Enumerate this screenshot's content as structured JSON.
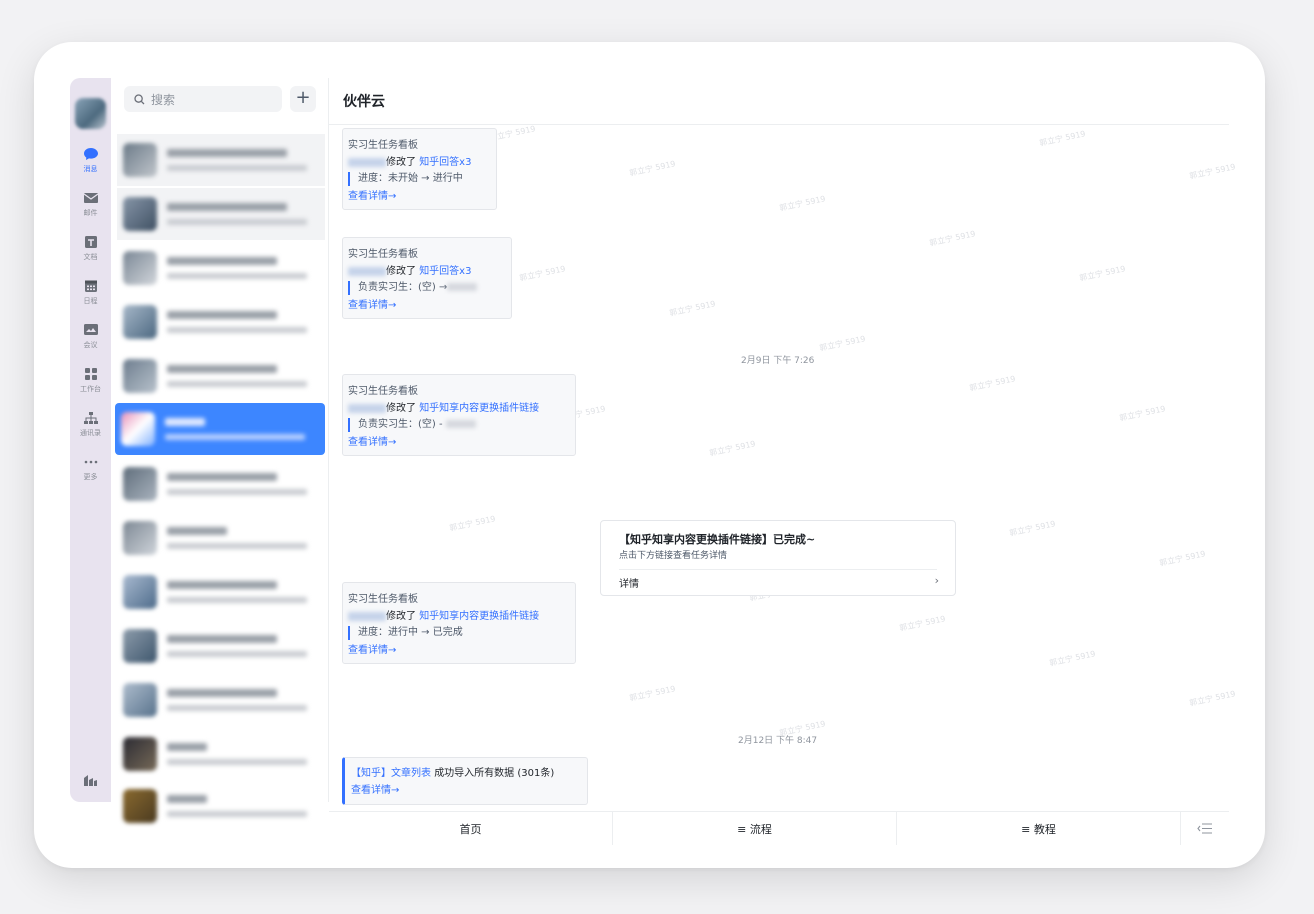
{
  "sidebar": {
    "items": [
      {
        "label": "消息",
        "icon": "chat-bubble-icon",
        "active": true
      },
      {
        "label": "邮件",
        "icon": "mail-icon"
      },
      {
        "label": "文档",
        "icon": "doc-icon"
      },
      {
        "label": "日程",
        "icon": "calendar-icon"
      },
      {
        "label": "会议",
        "icon": "video-icon"
      },
      {
        "label": "工作台",
        "icon": "grid-icon"
      },
      {
        "label": "通讯录",
        "icon": "org-chart-icon"
      },
      {
        "label": "更多",
        "icon": "more-dots-icon"
      }
    ]
  },
  "search": {
    "placeholder": "搜索"
  },
  "chat": {
    "title": "伙伴云",
    "cards": [
      {
        "header": "实习生任务看板",
        "action": "修改了",
        "link": "知乎回答x3",
        "sub": "进度：未开始 → 进行中",
        "detail": "查看详情→"
      },
      {
        "header": "实习生任务看板",
        "action": "修改了",
        "link": "知乎回答x3",
        "sub": "负责实习生：(空) →",
        "detail": "查看详情→"
      },
      {
        "header": "实习生任务看板",
        "action": "修改了",
        "link": "知乎知享内容更换插件链接",
        "sub": "负责实习生：(空) -",
        "detail": "查看详情→"
      },
      {
        "header": "实习生任务看板",
        "action": "修改了",
        "link": "知乎知享内容更换插件链接",
        "sub": "进度：进行中 → 已完成",
        "detail": "查看详情→"
      }
    ],
    "timestamp_1": "2月9日 下午 7:26",
    "timestamp_2": "2月12日 下午 8:47",
    "done_card": {
      "title": "【知乎知享内容更换插件链接】已完成~",
      "subtitle": "点击下方链接查看任务详情",
      "detail": "详情"
    },
    "import_card": {
      "link": "【知乎】文章列表",
      "text": "成功导入所有数据 (301条)",
      "detail": "查看详情→"
    },
    "watermark": "郭立宁 5919"
  },
  "tabs": [
    {
      "label": "首页"
    },
    {
      "label": "≡ 流程"
    },
    {
      "label": "≡ 教程"
    }
  ],
  "colors": {
    "accent": "#3370ff",
    "selected_row": "#3d86ff",
    "rail_bg": "#e8e3ef"
  }
}
